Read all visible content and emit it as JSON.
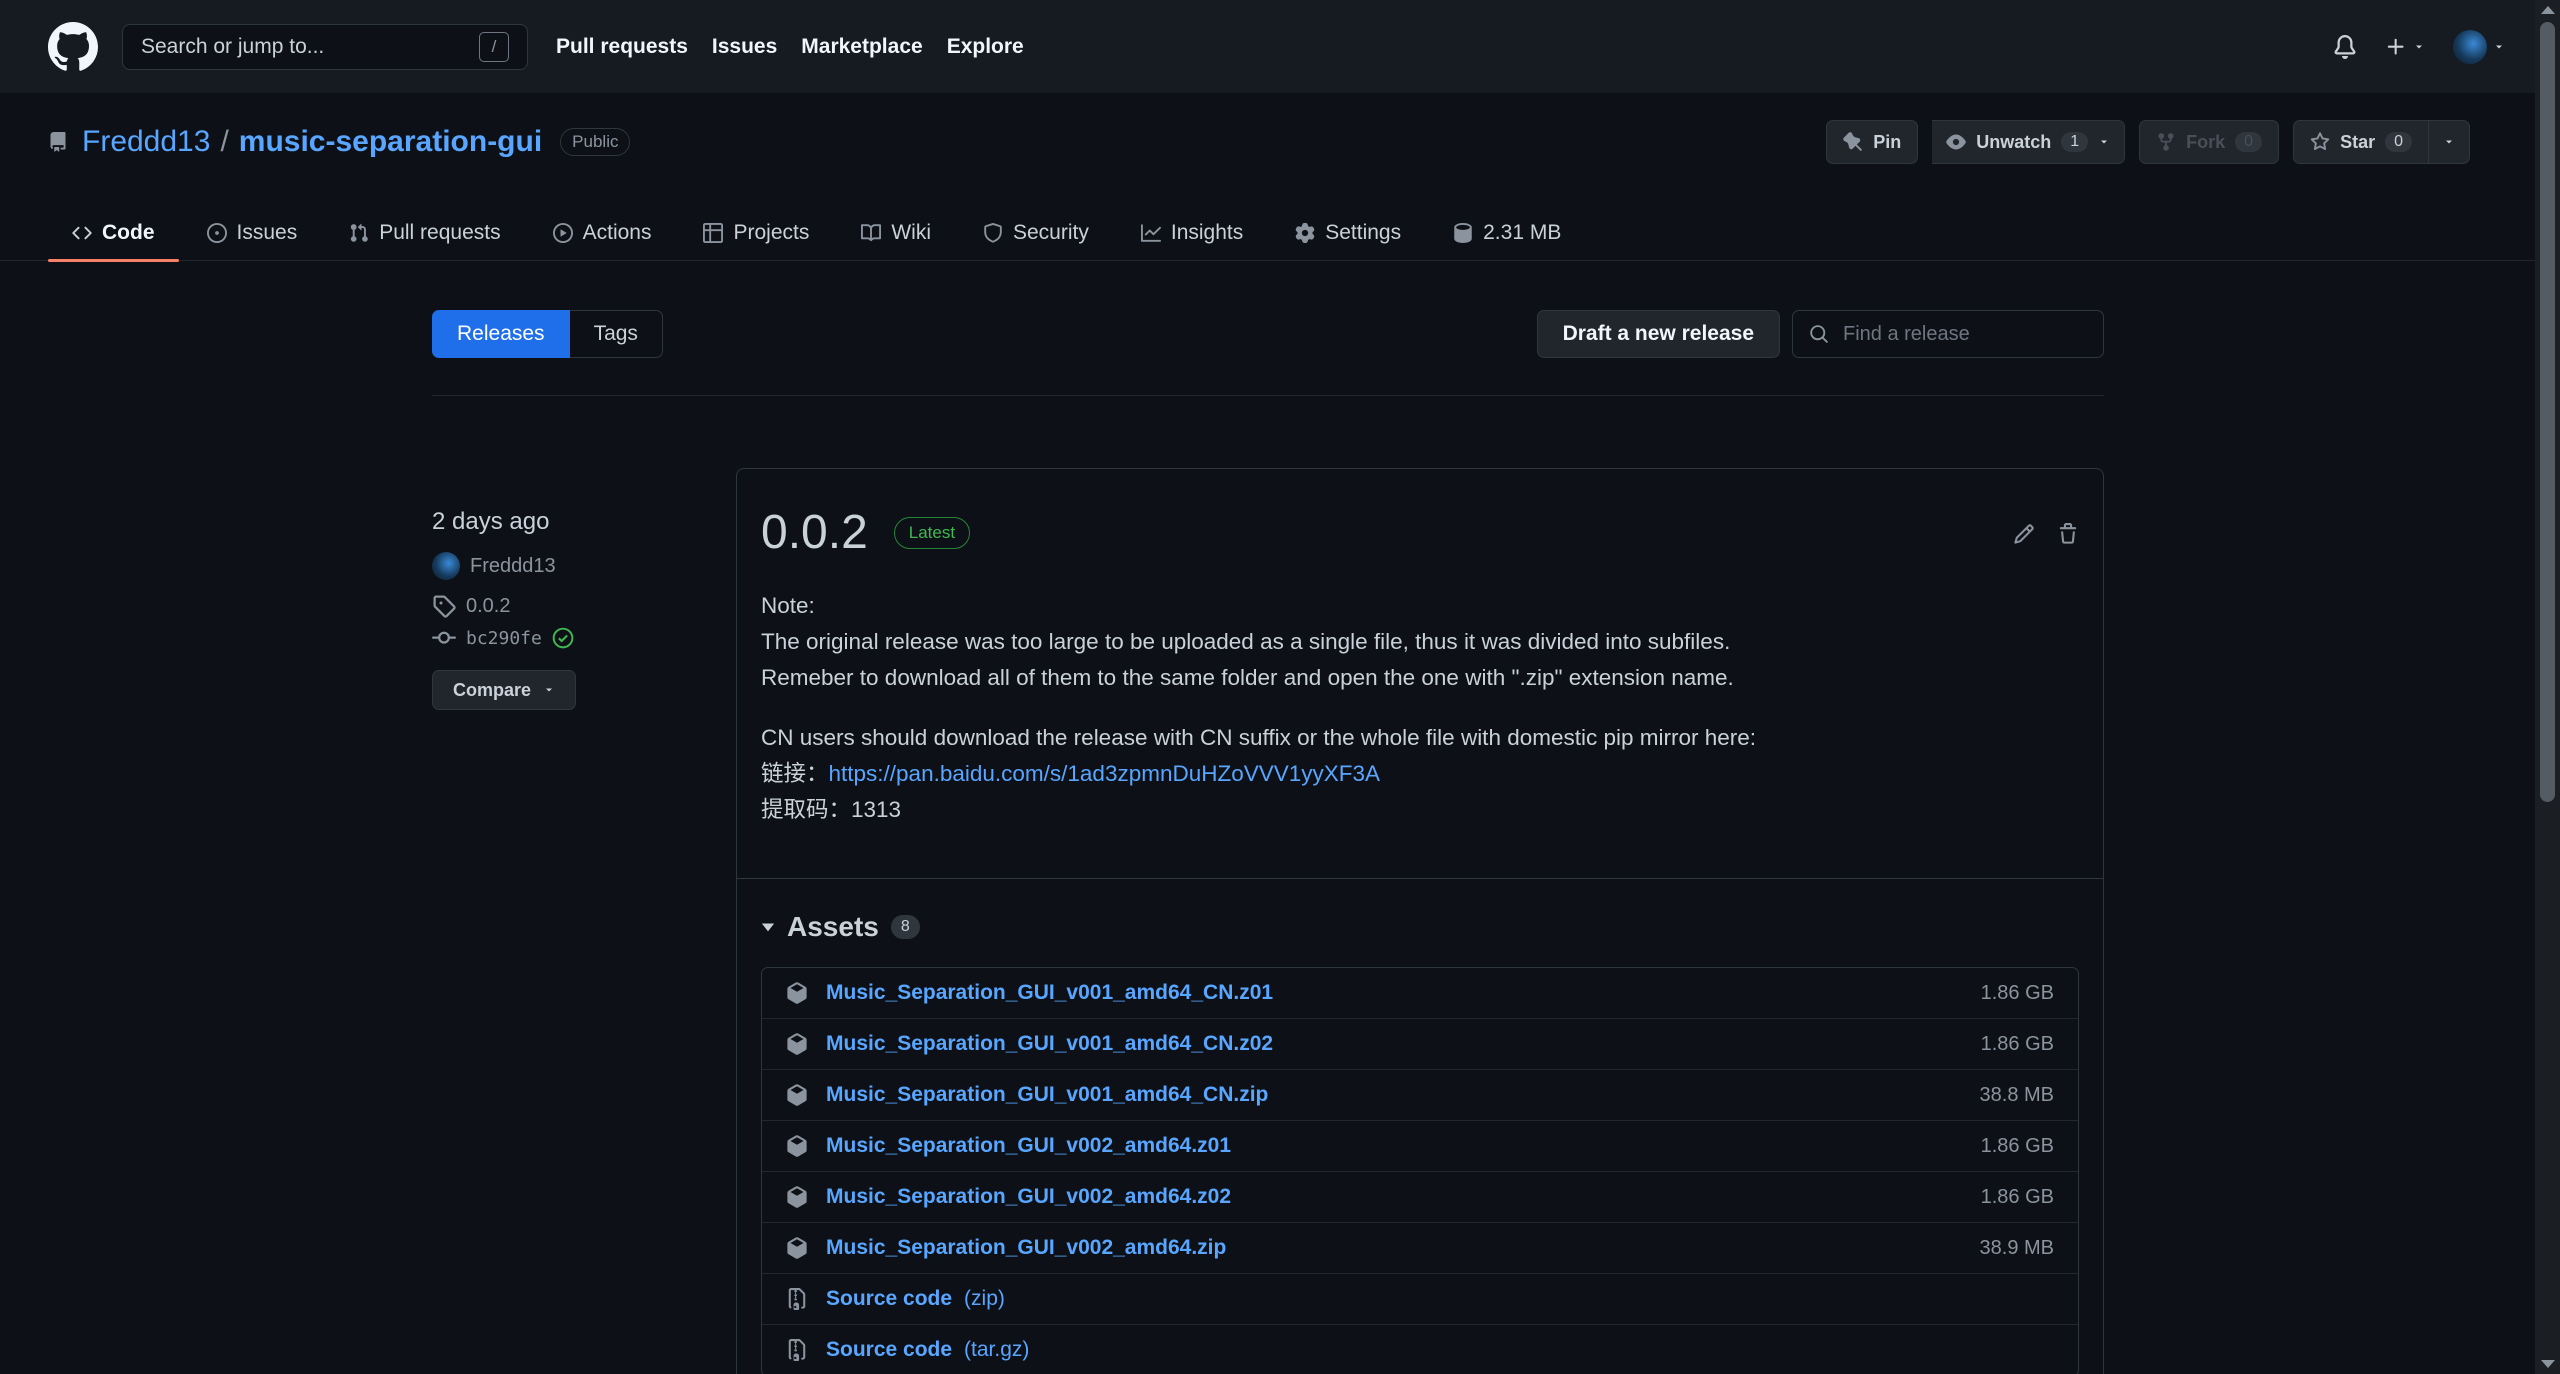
{
  "header": {
    "search_placeholder": "Search or jump to...",
    "search_shortcut": "/",
    "nav": [
      "Pull requests",
      "Issues",
      "Marketplace",
      "Explore"
    ]
  },
  "repo": {
    "owner": "Freddd13",
    "separator": "/",
    "name": "music-separation-gui",
    "visibility": "Public",
    "pin_label": "Pin",
    "unwatch_label": "Unwatch",
    "watch_count": "1",
    "fork_label": "Fork",
    "fork_count": "0",
    "star_label": "Star",
    "star_count": "0"
  },
  "tabs": [
    {
      "label": "Code",
      "icon": "code-icon"
    },
    {
      "label": "Issues",
      "icon": "issue-icon"
    },
    {
      "label": "Pull requests",
      "icon": "pull-request-icon"
    },
    {
      "label": "Actions",
      "icon": "play-icon"
    },
    {
      "label": "Projects",
      "icon": "table-icon"
    },
    {
      "label": "Wiki",
      "icon": "book-icon"
    },
    {
      "label": "Security",
      "icon": "shield-icon"
    },
    {
      "label": "Insights",
      "icon": "graph-icon"
    },
    {
      "label": "Settings",
      "icon": "gear-icon"
    },
    {
      "label": "2.31 MB",
      "icon": "database-icon"
    }
  ],
  "subnav": {
    "releases_label": "Releases",
    "tags_label": "Tags",
    "draft_label": "Draft a new release",
    "find_placeholder": "Find a release"
  },
  "release": {
    "date": "2 days ago",
    "author": "Freddd13",
    "tag": "0.0.2",
    "commit": "bc290fe",
    "compare_label": "Compare",
    "version": "0.0.2",
    "latest_label": "Latest",
    "note_line1": "Note:",
    "note_line2": "The original release was too large to be uploaded as a single file, thus it was divided into subfiles.",
    "note_line3": "Remeber to download all of them to the same folder and open the one with \".zip\" extension name.",
    "cn_line1": "CN users should download the release with CN suffix or the whole file with domestic pip mirror here:",
    "cn_link_prefix": "链接：",
    "cn_link": "https://pan.baidu.com/s/1ad3zpmnDuHZoVVV1yyXF3A",
    "cn_code_line": "提取码：1313"
  },
  "assets": {
    "title": "Assets",
    "count": "8",
    "items": [
      {
        "name": "Music_Separation_GUI_v001_amd64_CN.z01",
        "size": "1.86 GB"
      },
      {
        "name": "Music_Separation_GUI_v001_amd64_CN.z02",
        "size": "1.86 GB"
      },
      {
        "name": "Music_Separation_GUI_v001_amd64_CN.zip",
        "size": "38.8 MB"
      },
      {
        "name": "Music_Separation_GUI_v002_amd64.z01",
        "size": "1.86 GB"
      },
      {
        "name": "Music_Separation_GUI_v002_amd64.z02",
        "size": "1.86 GB"
      },
      {
        "name": "Music_Separation_GUI_v002_amd64.zip",
        "size": "38.9 MB"
      }
    ],
    "source": [
      {
        "name": "Source code",
        "ext": "(zip)"
      },
      {
        "name": "Source code",
        "ext": "(tar.gz)"
      }
    ]
  },
  "colors": {
    "accent": "#1f6feb",
    "link": "#58a6ff",
    "latest": "#3fb950",
    "tab_underline": "#f78166"
  }
}
